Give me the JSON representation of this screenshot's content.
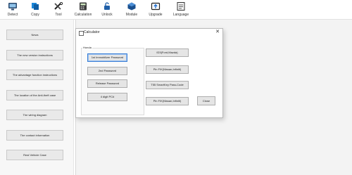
{
  "toolbar": {
    "items": [
      {
        "label": "Detect",
        "icon": "monitor-icon"
      },
      {
        "label": "Copy",
        "icon": "copy-icon"
      },
      {
        "label": "Tool",
        "icon": "tools-icon"
      },
      {
        "label": "Calculation",
        "icon": "calculator-icon"
      },
      {
        "label": "Unlock",
        "icon": "unlock-icon"
      },
      {
        "label": "Module",
        "icon": "module-icon"
      },
      {
        "label": "Upgrade",
        "icon": "upgrade-icon"
      },
      {
        "label": "Language",
        "icon": "language-icon"
      }
    ]
  },
  "sidebar": {
    "items": [
      {
        "label": "News"
      },
      {
        "label": "The new version instructions"
      },
      {
        "label": "The advantage function instructions"
      },
      {
        "label": "The location of the Anti-theft case"
      },
      {
        "label": "The wiring diagram"
      },
      {
        "label": "The contact information"
      },
      {
        "label": "Real Vehicle Case"
      }
    ]
  },
  "dialog": {
    "title": "Calculator",
    "close_glyph": "✕",
    "group_label": "Honda",
    "left_buttons": [
      "1st Immobilizer Password",
      "2nd Password",
      "Release Password",
      "4 digit PC#"
    ],
    "right_buttons": [
      "ID3(Ford,Mazda)",
      "Pin F/K(Nissan,Infiniti)",
      "T55 SmartKey Pass-Code",
      "Pin F/K(Nissan,Infiniti)"
    ],
    "close_label": "Close"
  },
  "colors": {
    "accent": "#1f6fd0",
    "focus_border": "#3c7fd6"
  }
}
